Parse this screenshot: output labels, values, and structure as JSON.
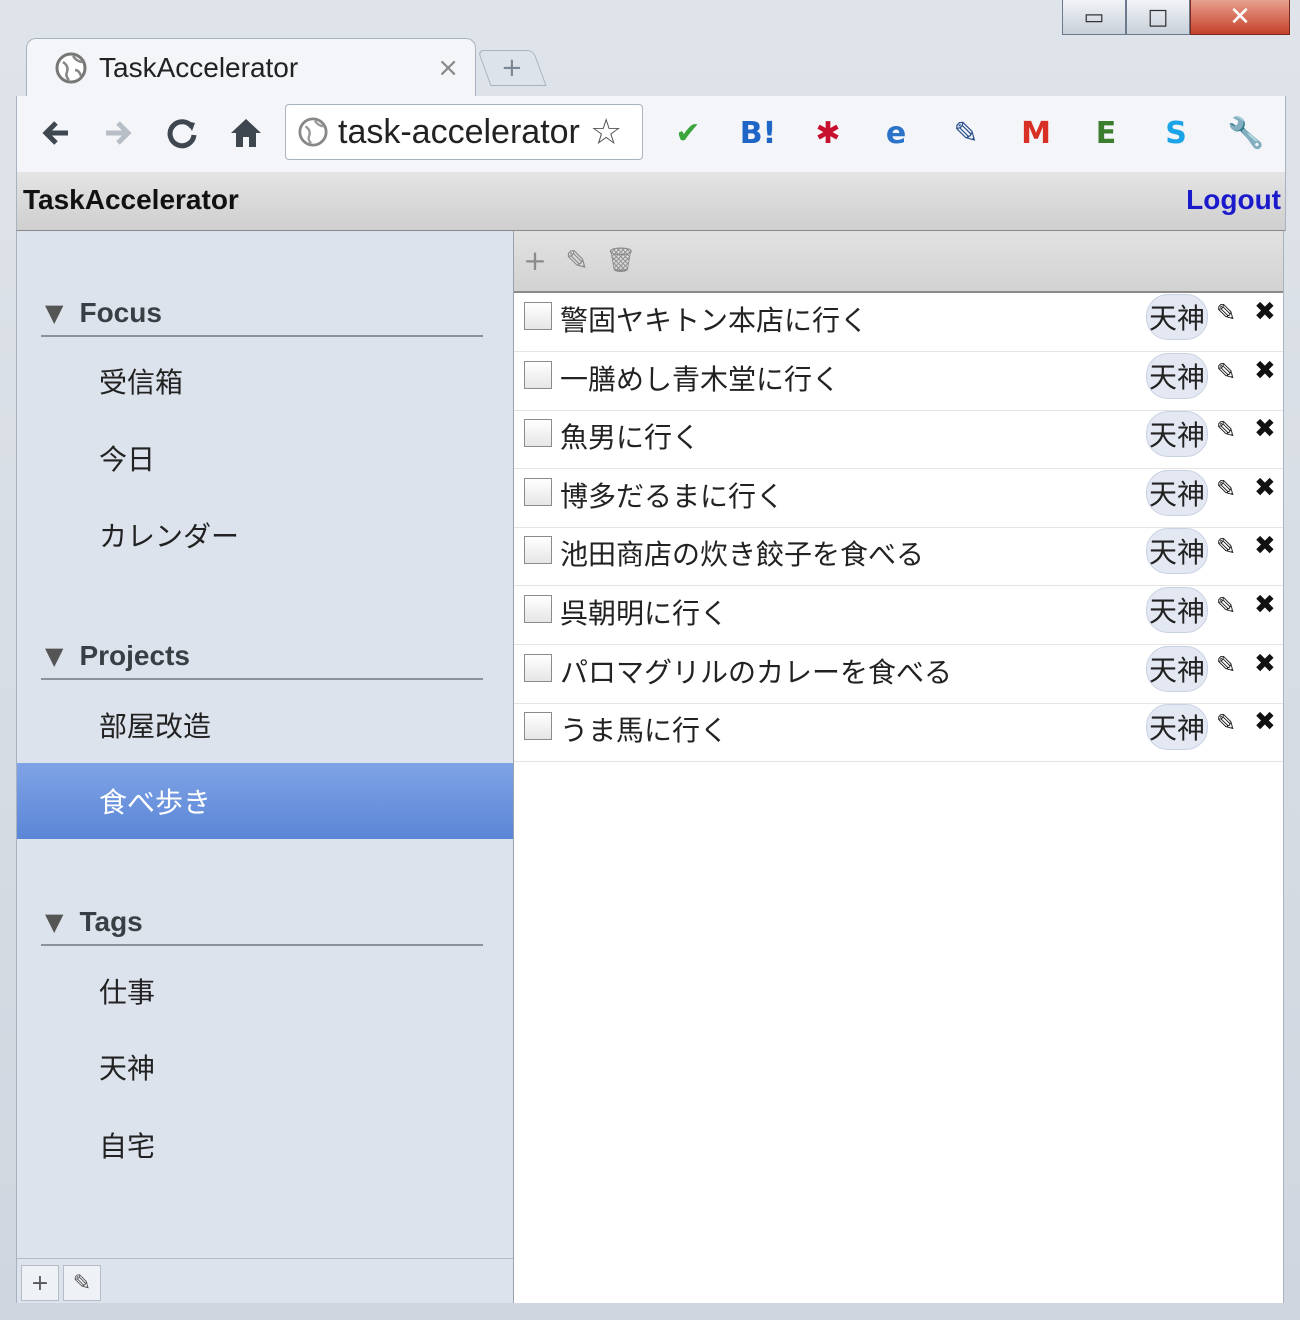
{
  "browser": {
    "tab_title": "TaskAccelerator",
    "tab_close": "×",
    "new_tab": "+",
    "address": "task-accelerator",
    "window_buttons": {
      "minimize": "▭",
      "maximize": "□",
      "close": "✕"
    },
    "extensions": [
      {
        "name": "check-extension-icon",
        "glyph": "✔",
        "color": "#3aa53a"
      },
      {
        "name": "hatena-bookmark-icon",
        "glyph": "B!",
        "color": "#1f66c7"
      },
      {
        "name": "lastpass-icon",
        "glyph": "✱",
        "color": "#c8102e"
      },
      {
        "name": "ie-tab-icon",
        "glyph": "e",
        "color": "#2b73c9"
      },
      {
        "name": "eyedropper-icon",
        "glyph": "✎",
        "color": "#2b4f8c"
      },
      {
        "name": "gmail-icon",
        "glyph": "M",
        "color": "#d93025"
      },
      {
        "name": "evernote-icon",
        "glyph": "E",
        "color": "#3c7d2e"
      },
      {
        "name": "skype-icon",
        "glyph": "S",
        "color": "#1aa3e6"
      },
      {
        "name": "wrench-icon",
        "glyph": "🔧",
        "color": "#333333"
      }
    ]
  },
  "app": {
    "title": "TaskAccelerator",
    "logout": "Logout"
  },
  "sidebar": {
    "focus": {
      "title": "Focus",
      "items": [
        "受信箱",
        "今日",
        "カレンダー"
      ]
    },
    "projects": {
      "title": "Projects",
      "items": [
        "部屋改造",
        "食べ歩き"
      ],
      "selected": "食べ歩き"
    },
    "tags": {
      "title": "Tags",
      "items": [
        "仕事",
        "天神",
        "自宅"
      ]
    },
    "footer": {
      "add": "+",
      "edit": "✎"
    }
  },
  "main": {
    "toolbar": {
      "add": "+",
      "edit": "✎",
      "delete": "🗑"
    },
    "tasks": [
      {
        "text": "警固ヤキトン本店に行く",
        "tag": "天神"
      },
      {
        "text": "一膳めし青木堂に行く",
        "tag": "天神"
      },
      {
        "text": "魚男に行く",
        "tag": "天神"
      },
      {
        "text": "博多だるまに行く",
        "tag": "天神"
      },
      {
        "text": "池田商店の炊き餃子を食べる",
        "tag": "天神"
      },
      {
        "text": "呉朝明に行く",
        "tag": "天神"
      },
      {
        "text": "パロマグリルのカレーを食べる",
        "tag": "天神"
      },
      {
        "text": "うま馬に行く",
        "tag": "天神"
      }
    ]
  },
  "colors": {
    "selection": "#5b86d6",
    "link": "#1a1acc",
    "sidebar_bg": "#dde3ec"
  }
}
